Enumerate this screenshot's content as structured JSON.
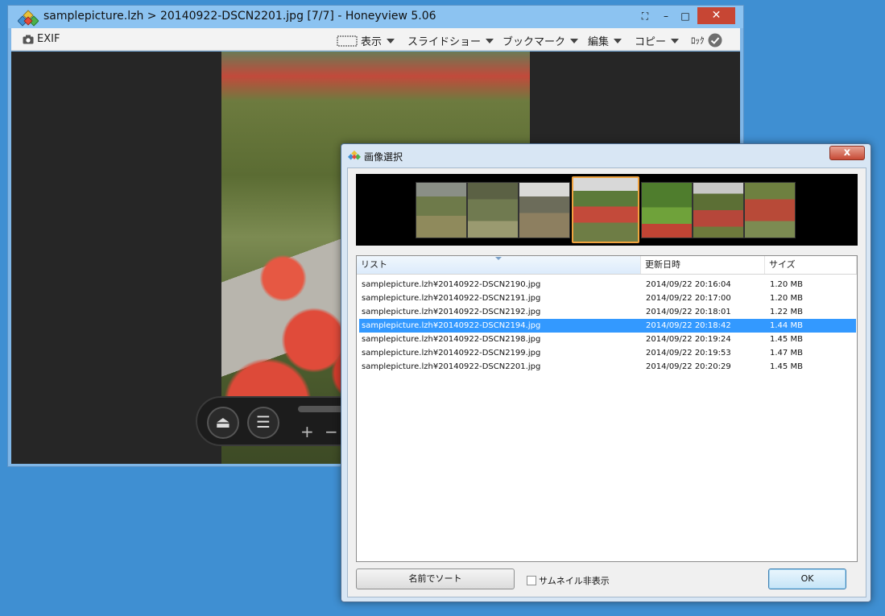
{
  "main_window": {
    "title": "samplepicture.lzh > 20140922-DSCN2201.jpg [7/7] - Honeyview 5.06",
    "caption_buttons": {
      "fullscreen": "⛶",
      "minimize": "–",
      "maximize": "□",
      "close": "✕"
    },
    "toolbar": {
      "exif": "EXIF",
      "view": "表示",
      "slideshow": "スライドショー",
      "bookmark": "ブックマーク",
      "edit": "編集",
      "copy": "コピー",
      "lock": "ﾛｯｸ"
    },
    "controls": {
      "eject": "⏏",
      "menu": "☰",
      "plus": "+",
      "minus": "−"
    }
  },
  "dialog": {
    "title": "画像選択",
    "close": "x",
    "columns": {
      "list": "リスト",
      "modified": "更新日時",
      "size": "サイズ"
    },
    "rows": [
      {
        "name": "samplepicture.lzh¥20140922-DSCN2190.jpg",
        "date": "2014/09/22 20:16:04",
        "size": "1.20 MB"
      },
      {
        "name": "samplepicture.lzh¥20140922-DSCN2191.jpg",
        "date": "2014/09/22 20:17:00",
        "size": "1.20 MB"
      },
      {
        "name": "samplepicture.lzh¥20140922-DSCN2192.jpg",
        "date": "2014/09/22 20:18:01",
        "size": "1.22 MB"
      },
      {
        "name": "samplepicture.lzh¥20140922-DSCN2194.jpg",
        "date": "2014/09/22 20:18:42",
        "size": "1.44 MB"
      },
      {
        "name": "samplepicture.lzh¥20140922-DSCN2198.jpg",
        "date": "2014/09/22 20:19:24",
        "size": "1.45 MB"
      },
      {
        "name": "samplepicture.lzh¥20140922-DSCN2199.jpg",
        "date": "2014/09/22 20:19:53",
        "size": "1.47 MB"
      },
      {
        "name": "samplepicture.lzh¥20140922-DSCN2201.jpg",
        "date": "2014/09/22 20:20:29",
        "size": "1.45 MB"
      }
    ],
    "selected_index": 3,
    "sort_button": "名前でソート",
    "hide_thumbnails": "サムネイル非表示",
    "ok": "OK"
  },
  "colors": {
    "desktop": "#3f8fd2",
    "selection": "#3399ff",
    "thumb_highlight": "#f0a33f",
    "close_red": "#c74634"
  }
}
